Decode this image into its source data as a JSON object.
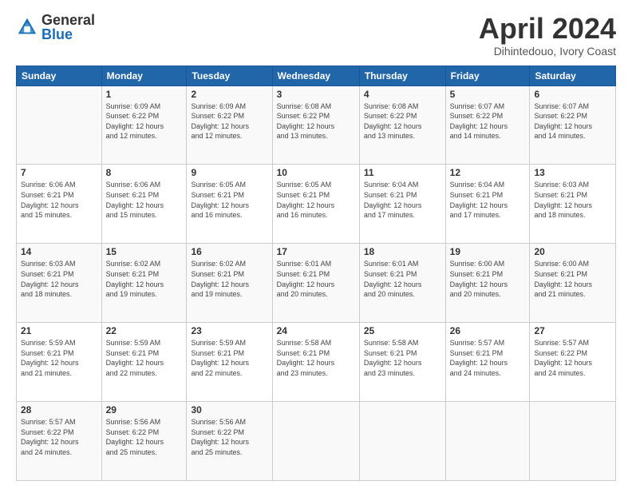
{
  "header": {
    "logo_general": "General",
    "logo_blue": "Blue",
    "month_title": "April 2024",
    "location": "Dihintedouo, Ivory Coast"
  },
  "calendar": {
    "days_of_week": [
      "Sunday",
      "Monday",
      "Tuesday",
      "Wednesday",
      "Thursday",
      "Friday",
      "Saturday"
    ],
    "weeks": [
      [
        {
          "day": "",
          "info": ""
        },
        {
          "day": "1",
          "info": "Sunrise: 6:09 AM\nSunset: 6:22 PM\nDaylight: 12 hours\nand 12 minutes."
        },
        {
          "day": "2",
          "info": "Sunrise: 6:09 AM\nSunset: 6:22 PM\nDaylight: 12 hours\nand 12 minutes."
        },
        {
          "day": "3",
          "info": "Sunrise: 6:08 AM\nSunset: 6:22 PM\nDaylight: 12 hours\nand 13 minutes."
        },
        {
          "day": "4",
          "info": "Sunrise: 6:08 AM\nSunset: 6:22 PM\nDaylight: 12 hours\nand 13 minutes."
        },
        {
          "day": "5",
          "info": "Sunrise: 6:07 AM\nSunset: 6:22 PM\nDaylight: 12 hours\nand 14 minutes."
        },
        {
          "day": "6",
          "info": "Sunrise: 6:07 AM\nSunset: 6:22 PM\nDaylight: 12 hours\nand 14 minutes."
        }
      ],
      [
        {
          "day": "7",
          "info": "Sunrise: 6:06 AM\nSunset: 6:21 PM\nDaylight: 12 hours\nand 15 minutes."
        },
        {
          "day": "8",
          "info": "Sunrise: 6:06 AM\nSunset: 6:21 PM\nDaylight: 12 hours\nand 15 minutes."
        },
        {
          "day": "9",
          "info": "Sunrise: 6:05 AM\nSunset: 6:21 PM\nDaylight: 12 hours\nand 16 minutes."
        },
        {
          "day": "10",
          "info": "Sunrise: 6:05 AM\nSunset: 6:21 PM\nDaylight: 12 hours\nand 16 minutes."
        },
        {
          "day": "11",
          "info": "Sunrise: 6:04 AM\nSunset: 6:21 PM\nDaylight: 12 hours\nand 17 minutes."
        },
        {
          "day": "12",
          "info": "Sunrise: 6:04 AM\nSunset: 6:21 PM\nDaylight: 12 hours\nand 17 minutes."
        },
        {
          "day": "13",
          "info": "Sunrise: 6:03 AM\nSunset: 6:21 PM\nDaylight: 12 hours\nand 18 minutes."
        }
      ],
      [
        {
          "day": "14",
          "info": "Sunrise: 6:03 AM\nSunset: 6:21 PM\nDaylight: 12 hours\nand 18 minutes."
        },
        {
          "day": "15",
          "info": "Sunrise: 6:02 AM\nSunset: 6:21 PM\nDaylight: 12 hours\nand 19 minutes."
        },
        {
          "day": "16",
          "info": "Sunrise: 6:02 AM\nSunset: 6:21 PM\nDaylight: 12 hours\nand 19 minutes."
        },
        {
          "day": "17",
          "info": "Sunrise: 6:01 AM\nSunset: 6:21 PM\nDaylight: 12 hours\nand 20 minutes."
        },
        {
          "day": "18",
          "info": "Sunrise: 6:01 AM\nSunset: 6:21 PM\nDaylight: 12 hours\nand 20 minutes."
        },
        {
          "day": "19",
          "info": "Sunrise: 6:00 AM\nSunset: 6:21 PM\nDaylight: 12 hours\nand 20 minutes."
        },
        {
          "day": "20",
          "info": "Sunrise: 6:00 AM\nSunset: 6:21 PM\nDaylight: 12 hours\nand 21 minutes."
        }
      ],
      [
        {
          "day": "21",
          "info": "Sunrise: 5:59 AM\nSunset: 6:21 PM\nDaylight: 12 hours\nand 21 minutes."
        },
        {
          "day": "22",
          "info": "Sunrise: 5:59 AM\nSunset: 6:21 PM\nDaylight: 12 hours\nand 22 minutes."
        },
        {
          "day": "23",
          "info": "Sunrise: 5:59 AM\nSunset: 6:21 PM\nDaylight: 12 hours\nand 22 minutes."
        },
        {
          "day": "24",
          "info": "Sunrise: 5:58 AM\nSunset: 6:21 PM\nDaylight: 12 hours\nand 23 minutes."
        },
        {
          "day": "25",
          "info": "Sunrise: 5:58 AM\nSunset: 6:21 PM\nDaylight: 12 hours\nand 23 minutes."
        },
        {
          "day": "26",
          "info": "Sunrise: 5:57 AM\nSunset: 6:21 PM\nDaylight: 12 hours\nand 24 minutes."
        },
        {
          "day": "27",
          "info": "Sunrise: 5:57 AM\nSunset: 6:22 PM\nDaylight: 12 hours\nand 24 minutes."
        }
      ],
      [
        {
          "day": "28",
          "info": "Sunrise: 5:57 AM\nSunset: 6:22 PM\nDaylight: 12 hours\nand 24 minutes."
        },
        {
          "day": "29",
          "info": "Sunrise: 5:56 AM\nSunset: 6:22 PM\nDaylight: 12 hours\nand 25 minutes."
        },
        {
          "day": "30",
          "info": "Sunrise: 5:56 AM\nSunset: 6:22 PM\nDaylight: 12 hours\nand 25 minutes."
        },
        {
          "day": "",
          "info": ""
        },
        {
          "day": "",
          "info": ""
        },
        {
          "day": "",
          "info": ""
        },
        {
          "day": "",
          "info": ""
        }
      ]
    ]
  }
}
